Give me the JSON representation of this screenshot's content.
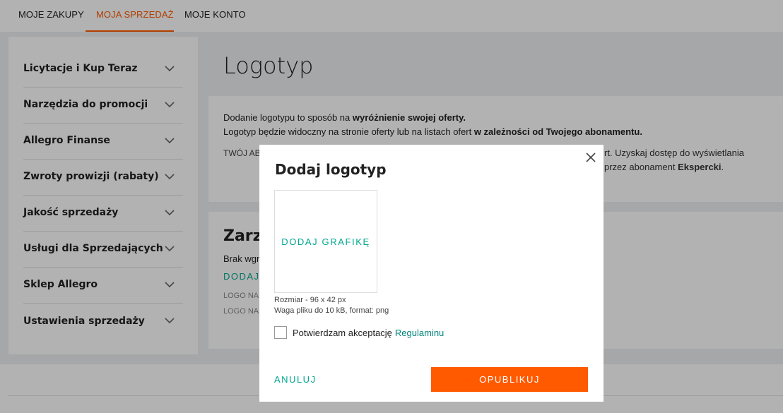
{
  "nav": {
    "tabs": [
      {
        "label": "MOJE ZAKUPY",
        "active": false
      },
      {
        "label": "MOJA SPRZEDAŻ",
        "active": true
      },
      {
        "label": "MOJE KONTO",
        "active": false
      }
    ]
  },
  "sidebar": {
    "items": [
      {
        "label": "Licytacje i Kup Teraz",
        "icon": "chevron-down-icon"
      },
      {
        "label": "Narzędzia do promocji",
        "icon": "chevron-down-icon"
      },
      {
        "label": "Allegro Finanse",
        "icon": "chevron-down-icon"
      },
      {
        "label": "Zwroty prowizji (rabaty)",
        "icon": "chevron-down-icon"
      },
      {
        "label": "Jakość sprzedaży",
        "icon": "chevron-down-icon"
      },
      {
        "label": "Usługi dla Sprzedających",
        "icon": "chevron-down-icon"
      },
      {
        "label": "Sklep Allegro",
        "icon": "chevron-down-icon"
      },
      {
        "label": "Ustawienia sprzedaży",
        "icon": "chevron-down-icon"
      }
    ]
  },
  "main": {
    "title": "Logotyp",
    "intro": {
      "line1_pre": "Dodanie logotypu to sposób na ",
      "line1_bold": "wyróżnienie swojej oferty.",
      "line2_pre": "Logotyp będzie widoczny na stronie oferty lub na listach ofert ",
      "line2_bold": "w zależności od Twojego abonamentu.",
      "abo_prefix": "TWÓJ AB",
      "right_line1": "rt. Uzyskaj dostęp do wyświetlania",
      "right_line2_pre": "przez abonament ",
      "right_line2_bold": "Ekspercki",
      "right_line2_post": "."
    },
    "manage": {
      "heading_partial": "Zarza",
      "empty_partial": "Brak wgr",
      "add_partial": "DODAJ",
      "logo_rows": [
        "LOGO NA",
        "LOGO NA"
      ]
    }
  },
  "modal": {
    "title": "Dodaj logotyp",
    "close_icon": "close-icon",
    "upload_label": "DODAJ GRAFIKĘ",
    "hint_size": "Rozmiar - 96 x 42 px",
    "hint_weight": "Waga pliku do 10 kB, format: png",
    "consent_text": "Potwierdzam akceptację",
    "consent_link": "Regulaminu",
    "consent_checked": false,
    "cancel_label": "ANULUJ",
    "publish_label": "OPUBLIKUJ"
  },
  "colors": {
    "accent": "#ff5a00",
    "link": "#00a790",
    "overlay": "rgba(0,0,0,0.30)"
  }
}
